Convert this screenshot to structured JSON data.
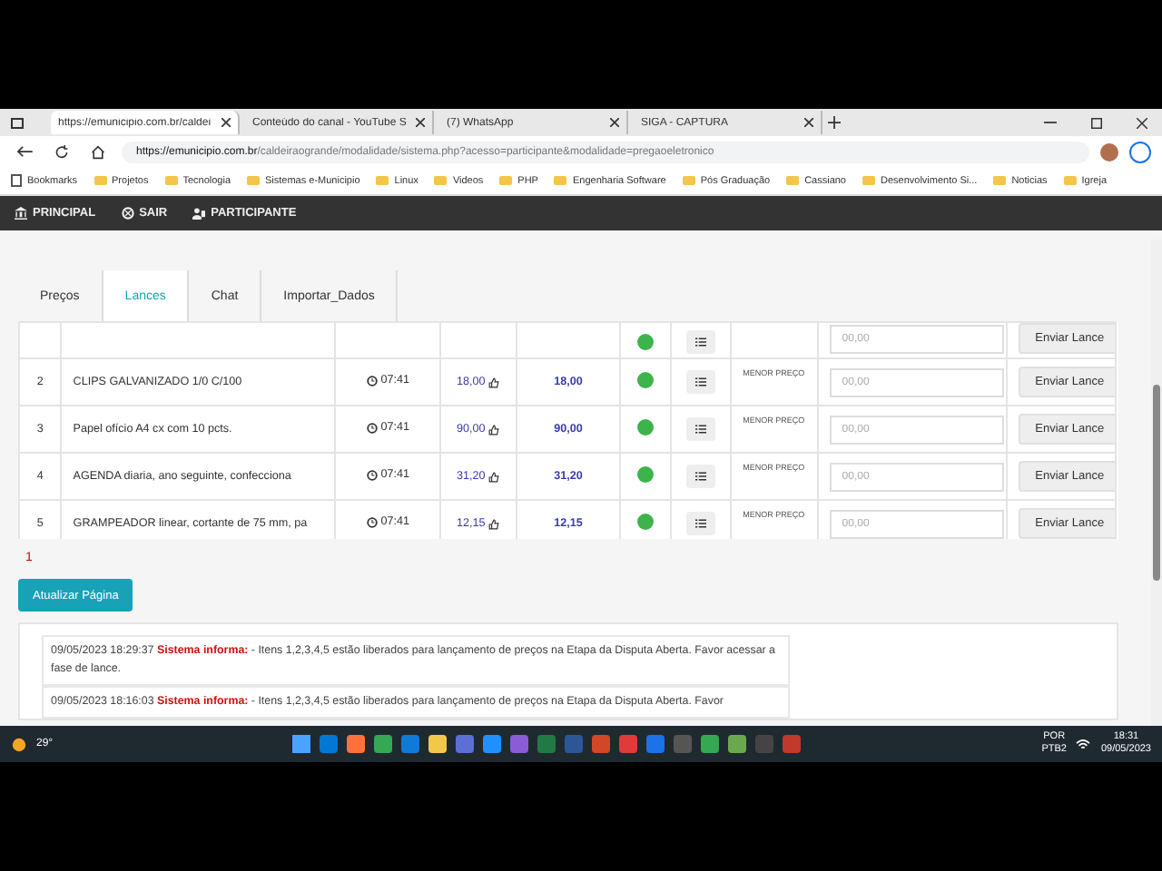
{
  "browser": {
    "tabs": [
      {
        "title": "https://emunicipio.com.br/caldei",
        "selected": true
      },
      {
        "title": "Conteúdo do canal - YouTube S",
        "selected": false
      },
      {
        "title": "(7) WhatsApp",
        "selected": false
      },
      {
        "title": "SIGA - CAPTURA",
        "selected": false
      }
    ],
    "url_host": "https://emunicipio.com.br",
    "url_path": "/caldeiraogrande/modalidade/sistema.php?acesso=participante&modalidade=pregaoeletronico",
    "bookmarks": [
      "Bookmarks",
      "Projetos",
      "Tecnologia",
      "Sistemas e-Municipio",
      "Linux",
      "Videos",
      "PHP",
      "Engenharia Software",
      "Pós Graduação",
      "Cassiano",
      "Desenvolvimento Si...",
      "Noticias",
      "Igreja"
    ]
  },
  "nav": [
    {
      "label": "PRINCIPAL",
      "kind": "bank"
    },
    {
      "label": "SAIR",
      "kind": "exit"
    },
    {
      "label": "PARTICIPANTE",
      "kind": "user"
    }
  ],
  "tabs": [
    {
      "label": "Preços",
      "selected": false
    },
    {
      "label": "Lances",
      "selected": true
    },
    {
      "label": "Chat",
      "selected": false
    },
    {
      "label": "Importar_Dados",
      "selected": false
    }
  ],
  "rows": [
    {
      "kind": "partial",
      "color": "#3cb44b",
      "placeholder": "00,00",
      "button": "Enviar Lance"
    },
    {
      "kind": "item",
      "number": "2",
      "description": "CLIPS GALVANIZADO 1/0 C/100",
      "time": "07:41",
      "price": "18,00",
      "best": "18,00",
      "color": "#3cb44b",
      "criterion": "MENOR PREÇO",
      "placeholder": "00,00",
      "button": "Enviar Lance"
    },
    {
      "kind": "item",
      "number": "3",
      "description": "Papel ofício A4 cx com 10 pcts.",
      "time": "07:41",
      "price": "90,00",
      "best": "90,00",
      "color": "#3cb44b",
      "criterion": "MENOR PREÇO",
      "placeholder": "00,00",
      "button": "Enviar Lance"
    },
    {
      "kind": "item",
      "number": "4",
      "description": "AGENDA diaria, ano seguinte, confecciona",
      "time": "07:41",
      "price": "31,20",
      "best": "31,20",
      "color": "#3cb44b",
      "criterion": "MENOR PREÇO",
      "placeholder": "00,00",
      "button": "Enviar Lance"
    },
    {
      "kind": "item",
      "number": "5",
      "description": "GRAMPEADOR linear, cortante de 75 mm, pa",
      "time": "07:41",
      "price": "12,15",
      "best": "12,15",
      "color": "#3cb44b",
      "criterion": "MENOR PREÇO",
      "placeholder": "00,00",
      "button": "Enviar Lance"
    }
  ],
  "pagination": [
    "1"
  ],
  "refresh_button": "Atualizar Página",
  "messages": [
    {
      "text": "09/05/2023 18:29:37 **Sistema informa:** - Itens 1,2,3,4,5 estão liberados para lançamento de preços na Etapa da Disputa Aberta. Favor acessar a fase de lance."
    },
    {
      "text": "09/05/2023 18:16:03 **Sistema informa:** - Itens 1,2,3,4,5 estão liberados para lançamento de preços na Etapa da Disputa Aberta. Favor"
    }
  ],
  "taskbar": {
    "weather": "29°",
    "language": "POR",
    "layout": "PTB2",
    "time": "18:31",
    "date": "09/05/2023"
  }
}
